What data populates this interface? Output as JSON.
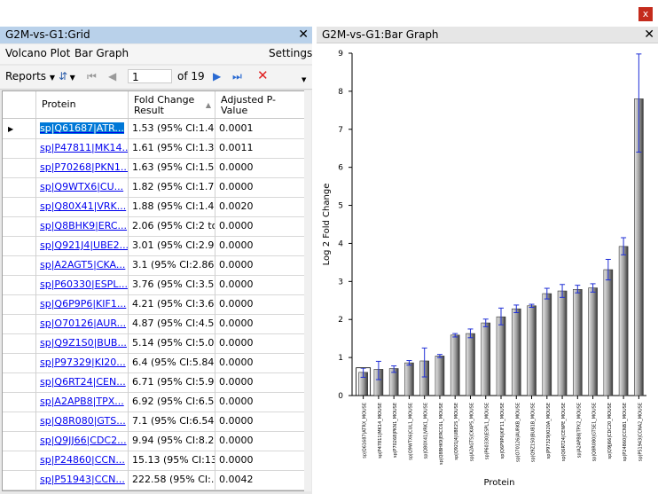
{
  "window": {
    "close_glyph": "x"
  },
  "left_panel": {
    "title": "G2M-vs-G1:Grid",
    "close_glyph": "✕",
    "menu": [
      "Volcano Plot",
      "Bar Graph",
      "Settings"
    ],
    "toolbar": {
      "reports_label": "Reports",
      "page_value": "1",
      "page_of": "of 19"
    },
    "columns": [
      "Protein",
      "Fold Change Result",
      "Adjusted P-Value"
    ],
    "rows": [
      {
        "protein": "sp|Q61687|ATR...",
        "fold": "1.53 (95% CI:1.4...",
        "p": "0.0001"
      },
      {
        "protein": "sp|P47811|MK14...",
        "fold": "1.61 (95% CI:1.3...",
        "p": "0.0011"
      },
      {
        "protein": "sp|P70268|PKN1...",
        "fold": "1.63 (95% CI:1.5...",
        "p": "0.0000"
      },
      {
        "protein": "sp|Q9WTX6|CU...",
        "fold": "1.82 (95% CI:1.7...",
        "p": "0.0000"
      },
      {
        "protein": "sp|Q80X41|VRK...",
        "fold": "1.88 (95% CI:1.4...",
        "p": "0.0020"
      },
      {
        "protein": "sp|Q8BHK9|ERC...",
        "fold": "2.06 (95% CI:2 to...",
        "p": "0.0000"
      },
      {
        "protein": "sp|Q921J4|UBE2...",
        "fold": "3.01 (95% CI:2.9...",
        "p": "0.0000"
      },
      {
        "protein": "sp|A2AGT5|CKA...",
        "fold": "3.1 (95% CI:2.86 ...",
        "p": "0.0000"
      },
      {
        "protein": "sp|P60330|ESPL...",
        "fold": "3.76 (95% CI:3.5...",
        "p": "0.0000"
      },
      {
        "protein": "sp|Q6P9P6|KIF1...",
        "fold": "4.21 (95% CI:3.6...",
        "p": "0.0000"
      },
      {
        "protein": "sp|O70126|AUR...",
        "fold": "4.87 (95% CI:4.5...",
        "p": "0.0000"
      },
      {
        "protein": "sp|Q9Z1S0|BUB...",
        "fold": "5.14 (95% CI:5.0...",
        "p": "0.0000"
      },
      {
        "protein": "sp|P97329|KI20...",
        "fold": "6.4 (95% CI:5.84 ...",
        "p": "0.0000"
      },
      {
        "protein": "sp|Q6RT24|CEN...",
        "fold": "6.71 (95% CI:5.9...",
        "p": "0.0000"
      },
      {
        "protein": "sp|A2APB8|TPX...",
        "fold": "6.92 (95% CI:6.5...",
        "p": "0.0000"
      },
      {
        "protein": "sp|Q8R080|GTS...",
        "fold": "7.1 (95% CI:6.54 ...",
        "p": "0.0000"
      },
      {
        "protein": "sp|Q9JJ66|CDC2...",
        "fold": "9.94 (95% CI:8.2...",
        "p": "0.0000"
      },
      {
        "protein": "sp|P24860|CCN...",
        "fold": "15.13 (95% CI:13...",
        "p": "0.0000"
      },
      {
        "protein": "sp|P51943|CCN...",
        "fold": "222.58 (95% CI:...",
        "p": "0.0042"
      }
    ]
  },
  "right_panel": {
    "title": "G2M-vs-G1:Bar Graph",
    "close_glyph": "✕"
  },
  "chart_data": {
    "type": "bar",
    "title": "",
    "xlabel": "Protein",
    "ylabel": "Log 2 Fold Change",
    "ylim": [
      0,
      9
    ],
    "yticks": [
      0,
      1,
      2,
      3,
      4,
      5,
      6,
      7,
      8,
      9
    ],
    "categories": [
      "sp|Q61687|ATRX_MOUSE",
      "sp|P47811|MK14_MOUSE",
      "sp|P70268|PKN1_MOUSE",
      "sp|Q9WTX6|CUL1_MOUSE",
      "sp|Q80X41|VRK1_MOUSE",
      "sp|Q8BHK9|ERCC6L_MOUSE",
      "sp|Q921J4|UBE2S_MOUSE",
      "sp|A2AGT5|CKAP5_MOUSE",
      "sp|P60330|ESPL1_MOUSE",
      "sp|Q6P9P6|KIF11_MOUSE",
      "sp|O70126|AURKB_MOUSE",
      "sp|Q9Z1S0|BUB1B_MOUSE",
      "sp|P97329|KI20A_MOUSE",
      "sp|Q6RT24|CENPE_MOUSE",
      "sp|A2APB8|TPX2_MOUSE",
      "sp|Q8R080|GTSE1_MOUSE",
      "sp|Q9JJ66|CDC20_MOUSE",
      "sp|P24860|CCNB1_MOUSE",
      "sp|P51943|CCNA2_MOUSE"
    ],
    "values": [
      0.61,
      0.69,
      0.71,
      0.86,
      0.91,
      1.04,
      1.59,
      1.63,
      1.91,
      2.07,
      2.28,
      2.36,
      2.68,
      2.75,
      2.79,
      2.83,
      3.31,
      3.92,
      7.8
    ],
    "err_low": [
      0.48,
      0.42,
      0.61,
      0.8,
      0.49,
      1.0,
      1.54,
      1.52,
      1.81,
      1.86,
      2.18,
      2.32,
      2.54,
      2.58,
      2.7,
      2.72,
      3.04,
      3.7,
      6.4
    ],
    "err_high": [
      0.72,
      0.9,
      0.78,
      0.92,
      1.25,
      1.08,
      1.63,
      1.75,
      2.01,
      2.3,
      2.38,
      2.4,
      2.82,
      2.92,
      2.9,
      2.94,
      3.58,
      4.15,
      8.98
    ],
    "legend": "none",
    "grid": false
  }
}
